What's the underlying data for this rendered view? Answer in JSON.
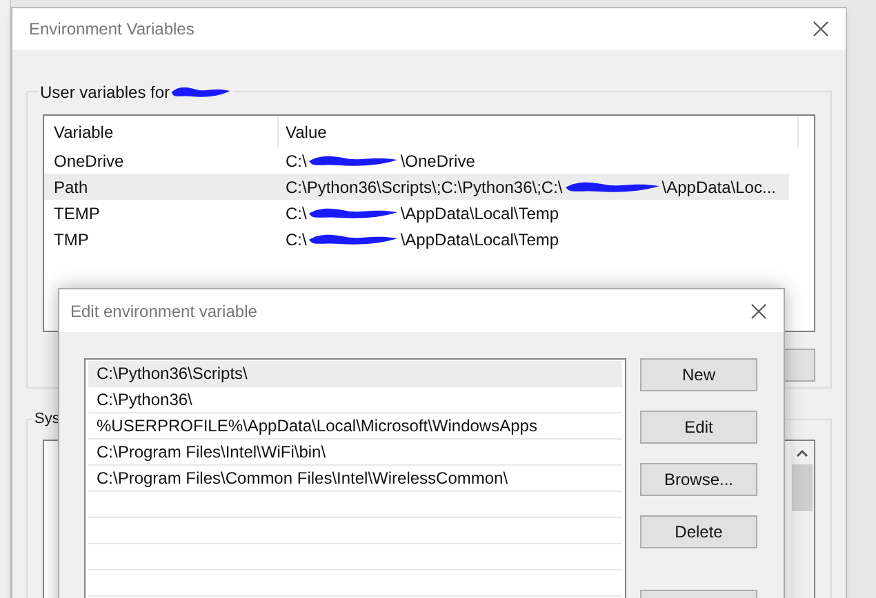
{
  "window": {
    "title": "Environment Variables"
  },
  "user_variables": {
    "label": "User variables for",
    "columns": [
      "Variable",
      "Value"
    ],
    "rows": [
      {
        "variable": "OneDrive",
        "value_parts": [
          "C:\\",
          "\\OneDrive"
        ],
        "selected": false
      },
      {
        "variable": "Path",
        "value_parts": [
          "C:\\Python36\\Scripts\\;C:\\Python36\\;C:\\",
          "\\AppData\\Loc..."
        ],
        "selected": true
      },
      {
        "variable": "TEMP",
        "value_parts": [
          "C:\\",
          "\\AppData\\Local\\Temp"
        ],
        "selected": false
      },
      {
        "variable": "TMP",
        "value_parts": [
          "C:\\",
          "\\AppData\\Local\\Temp"
        ],
        "selected": false
      }
    ]
  },
  "system_variables": {
    "label": "Sys"
  },
  "edit_dialog": {
    "title": "Edit environment variable",
    "entries": [
      {
        "text": "C:\\Python36\\Scripts\\",
        "selected": true
      },
      {
        "text": "C:\\Python36\\",
        "selected": false
      },
      {
        "text": "%USERPROFILE%\\AppData\\Local\\Microsoft\\WindowsApps",
        "selected": false
      },
      {
        "text": "C:\\Program Files\\Intel\\WiFi\\bin\\",
        "selected": false
      },
      {
        "text": "C:\\Program Files\\Common Files\\Intel\\WirelessCommon\\",
        "selected": false
      }
    ],
    "buttons": [
      "New",
      "Edit",
      "Browse...",
      "Delete"
    ]
  }
}
